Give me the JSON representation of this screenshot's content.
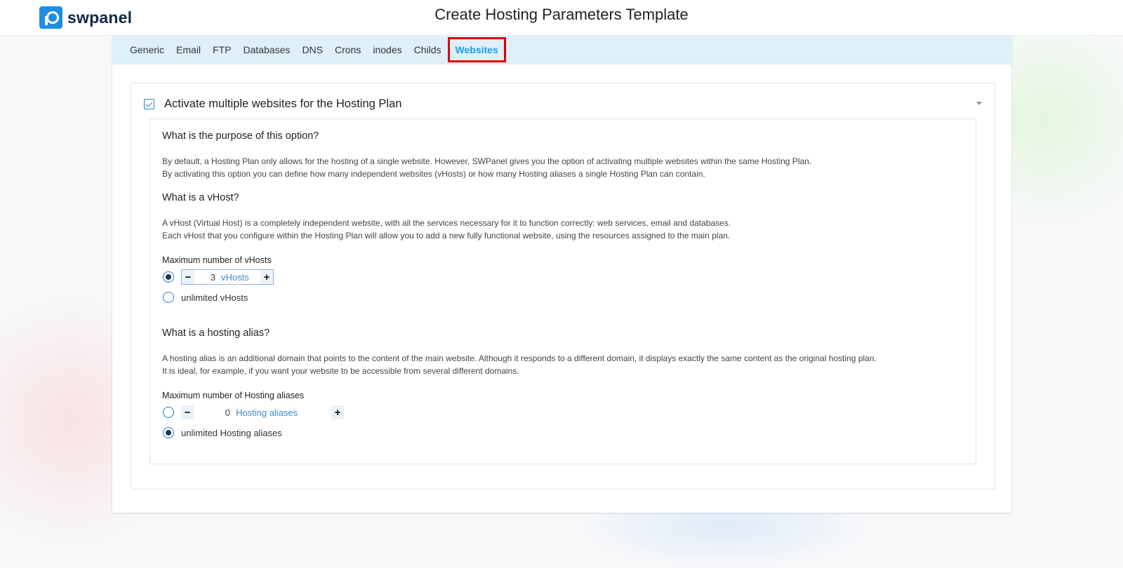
{
  "brand": {
    "name": "swpanel"
  },
  "page": {
    "title": "Create Hosting Parameters Template"
  },
  "tabs": [
    {
      "label": "Generic"
    },
    {
      "label": "Email"
    },
    {
      "label": "FTP"
    },
    {
      "label": "Databases"
    },
    {
      "label": "DNS"
    },
    {
      "label": "Crons"
    },
    {
      "label": "inodes"
    },
    {
      "label": "Childs"
    },
    {
      "label": "Websites",
      "active": true
    }
  ],
  "card": {
    "checkbox_label": "Activate multiple websites for the Hosting Plan",
    "checked": true
  },
  "purpose": {
    "title": "What is the purpose of this option?",
    "line1": "By default, a Hosting Plan only allows for the hosting of a single website. However, SWPanel gives you the option of activating multiple websites within the same Hosting Plan.",
    "line2": "By activating this option you can define how many independent websites (vHosts) or how many Hosting aliases a single Hosting Plan can contain."
  },
  "vhost": {
    "title": "What is a vHost?",
    "line1": "A vHost (Virtual Host) is a completely independent website, with all the services necessary for it to function correctly: web services, email and databases.",
    "line2": "Each vHost that you configure within the Hosting Plan will allow you to add a new fully functional website, using the resources assigned to the main plan.",
    "field_label": "Maximum number of vHosts",
    "value": "3",
    "unit": "vHosts",
    "unlimited_label": "unlimited vHosts",
    "selected": "limited"
  },
  "alias": {
    "title": "What is a hosting alias?",
    "line1": "A hosting alias is an additional domain that points to the content of the main website. Although it responds to a different domain, it displays exactly the same content as the original hosting plan.",
    "line2": "It is ideal, for example, if you want your website to be accessible from several different domains.",
    "field_label": "Maximum number of Hosting aliases",
    "value": "0",
    "unit": "Hosting aliases",
    "unlimited_label": "unlimited Hosting aliases",
    "selected": "unlimited"
  },
  "icons": {
    "logo": "swpanel-logo-icon",
    "checkbox": "checkbox-checked-icon",
    "collapse": "caret-down-icon",
    "minus": "−",
    "plus": "+"
  },
  "colors": {
    "accent": "#1a9be6",
    "highlight": "#e00000",
    "tab_bar": "#e0f0fb",
    "brand_dark": "#0e2a47"
  }
}
